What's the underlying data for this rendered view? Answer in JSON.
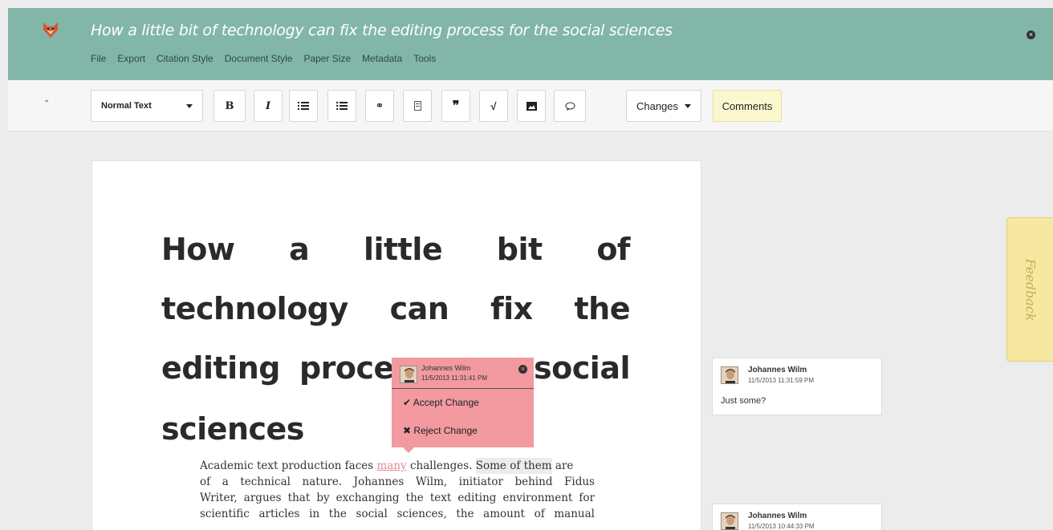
{
  "app": {
    "doc_title": "How a little bit of technology can fix the editing process for the social sciences",
    "menu": [
      "File",
      "Export",
      "Citation Style",
      "Document Style",
      "Paper Size",
      "Metadata",
      "Tools"
    ]
  },
  "toolbar": {
    "text_style": "Normal Text",
    "changes_label": "Changes",
    "comments_label": "Comments",
    "icons": [
      "bold-icon",
      "italic-icon",
      "numbered-list-icon",
      "bullet-list-icon",
      "link-icon",
      "footnote-icon",
      "quote-icon",
      "math-icon",
      "image-icon",
      "comment-icon"
    ]
  },
  "document": {
    "title_lines": [
      [
        "How",
        "a",
        "little",
        "bit",
        "of"
      ],
      [
        "technology",
        "can",
        "fix",
        "the"
      ],
      [
        "editing",
        "proces",
        "social"
      ],
      [
        "sciences"
      ]
    ],
    "body": {
      "l1_a": "Academic text production faces ",
      "l1_del": "many",
      "l1_b": " challenges. ",
      "l1_hl": "Some of them",
      "l1_c": " are",
      "l2": "of a technical nature. Johannes Wilm, initiator behind Fidus",
      "l3": "Writer, argues that by exchanging the text editing environment for",
      "l4": "scientific articles in the social sciences, the amount of manual"
    }
  },
  "change_popup": {
    "author": "Johannes Wilm",
    "time": "11/5/2013 11:31:41 PM",
    "accept_label": "Accept Change",
    "reject_label": "Reject Change"
  },
  "comments": [
    {
      "author": "Johannes Wilm",
      "time": "11/5/2013 11:31:59 PM",
      "text": "Just some?"
    },
    {
      "author": "Johannes Wilm",
      "time": "11/5/2013 10:44:33 PM",
      "text": ""
    }
  ],
  "feedback": {
    "label": "Feedback"
  },
  "colors": {
    "header": "#82b6a8",
    "popup": "#f29a9f",
    "comments_button": "#fbf8d0",
    "feedback": "#f6e8a1"
  }
}
